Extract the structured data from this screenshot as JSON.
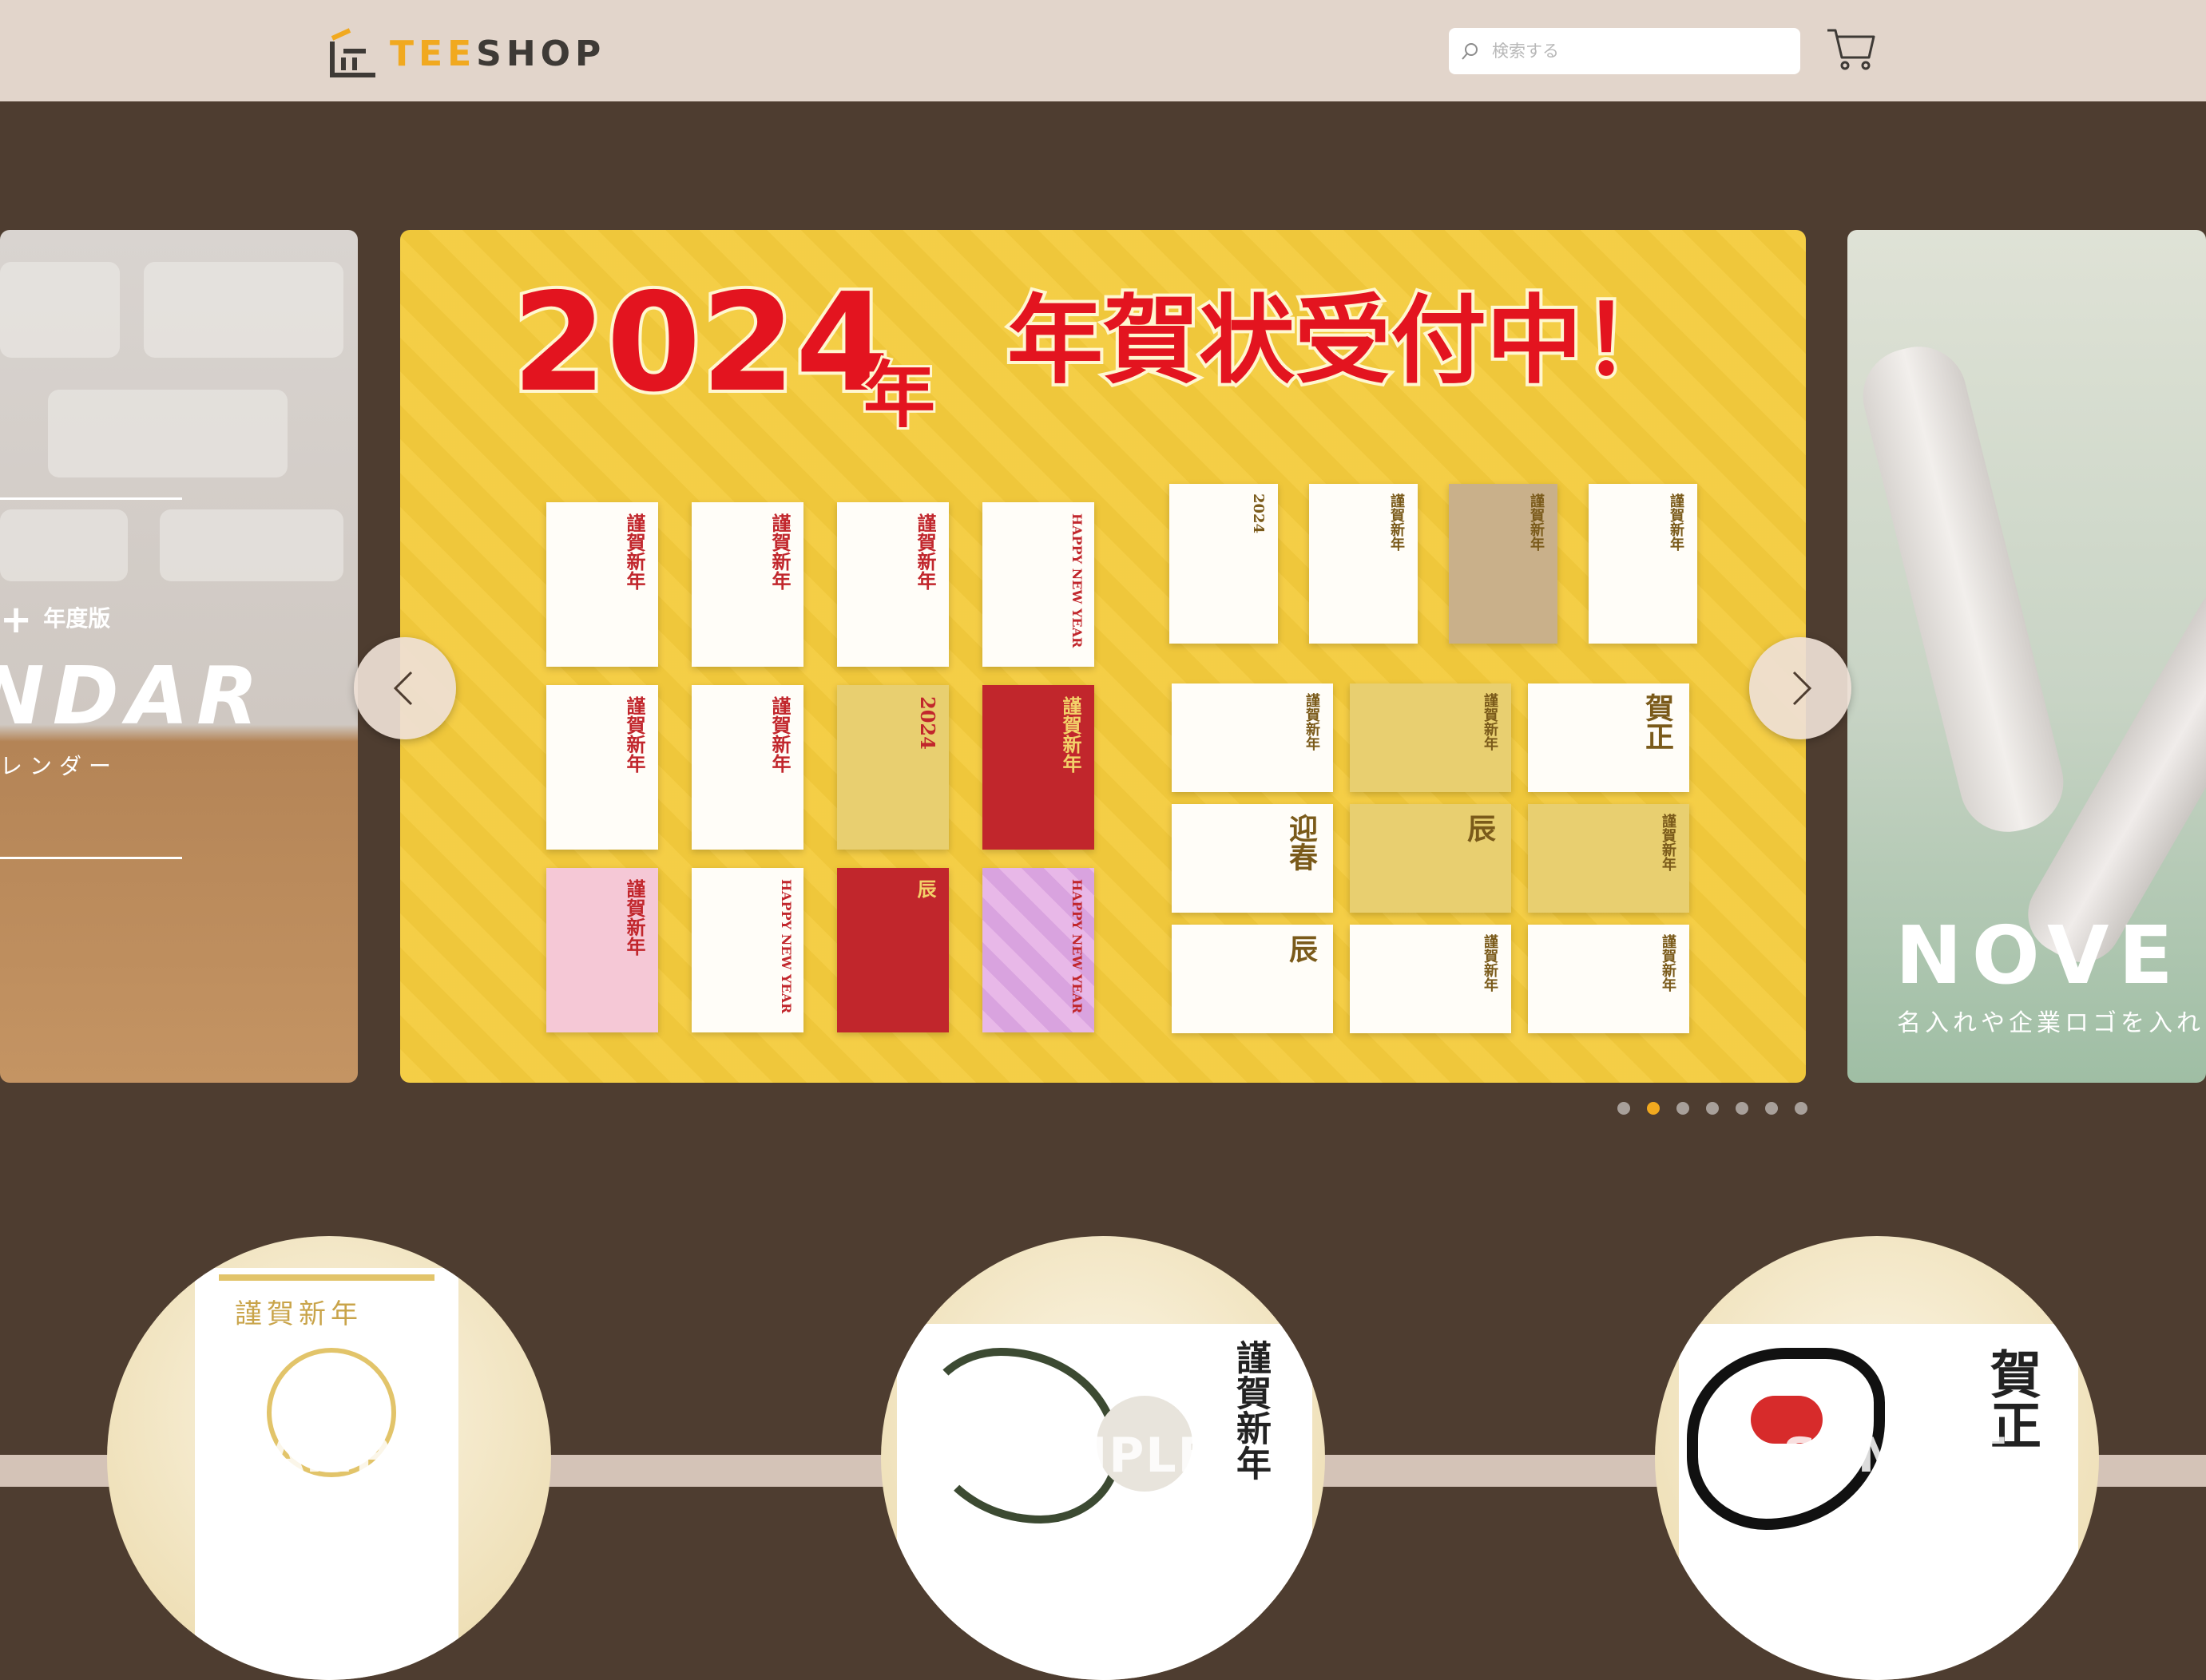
{
  "header": {
    "logo_tee": "TEE",
    "logo_shop": "SHOP",
    "search_placeholder": "検索する"
  },
  "colors": {
    "header_bg": "#e2d5cb",
    "page_bg": "#4e3d30",
    "accent": "#f1a91f",
    "banner_yellow": "#f4cb3c",
    "headline_red": "#e3141f"
  },
  "carousel": {
    "dot_count": 7,
    "active_dot_index": 1,
    "slide_left": {
      "plus": "+",
      "year_label": "年度版",
      "title": "NDAR",
      "subtitle": "レンダー"
    },
    "slide_main": {
      "year": "2024",
      "year_suffix": "年",
      "headline": "年賀状受付中！",
      "cards_left": [
        {
          "text": "謹賀新年"
        },
        {
          "text": "謹賀新年"
        },
        {
          "text": "謹賀新年"
        },
        {
          "text": "HAPPY NEW YEAR"
        },
        {
          "text": "謹賀新年"
        },
        {
          "text": "謹賀新年"
        },
        {
          "text": "2024"
        },
        {
          "text": "謹賀新年"
        },
        {
          "text": "謹賀新年"
        },
        {
          "text": "HAPPY NEW YEAR"
        },
        {
          "text": "辰"
        },
        {
          "text": "HAPPY NEW YEAR"
        }
      ],
      "cards_right": [
        {
          "text": "2024"
        },
        {
          "text": "謹賀新年"
        },
        {
          "text": "謹賀新年"
        },
        {
          "text": "謹賀新年"
        },
        {
          "text": "謹賀新年"
        },
        {
          "text": "謹賀新年"
        },
        {
          "text": "賀正"
        },
        {
          "text": "迎春"
        },
        {
          "text": "辰"
        },
        {
          "text": "謹賀新年"
        },
        {
          "text": "辰"
        },
        {
          "text": "謹賀新年"
        },
        {
          "text": "謹賀新年"
        }
      ]
    },
    "slide_right": {
      "title": "NOVE",
      "subtitle": "名入れや企業ロゴを入れ"
    }
  },
  "categories": [
    {
      "label": "謹賀新年",
      "sample": "SAMPLE"
    },
    {
      "label": "謹賀新年",
      "sample": "SAMPLE"
    },
    {
      "label": "賀正",
      "sample": "SAMPLE"
    }
  ]
}
